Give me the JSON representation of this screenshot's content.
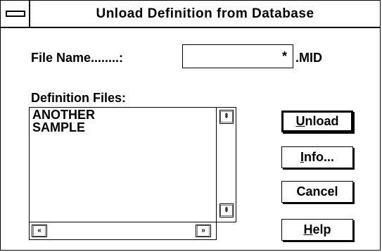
{
  "window": {
    "title": "Unload Definition from Database"
  },
  "file_name": {
    "label": "File Name........:",
    "value": "*",
    "extension": ".MID"
  },
  "definition_files": {
    "label": "Definition Files:",
    "items": [
      "ANOTHER",
      "SAMPLE"
    ]
  },
  "buttons": {
    "unload": {
      "mnemonic": "U",
      "rest": "nload"
    },
    "info": {
      "mnemonic": "I",
      "rest": "nfo..."
    },
    "cancel": {
      "label": "Cancel"
    },
    "help": {
      "mnemonic": "H",
      "rest": "elp"
    }
  },
  "scroll_glyphs": {
    "up": "⇞",
    "down": "⇟",
    "left": "«",
    "right": "»"
  }
}
